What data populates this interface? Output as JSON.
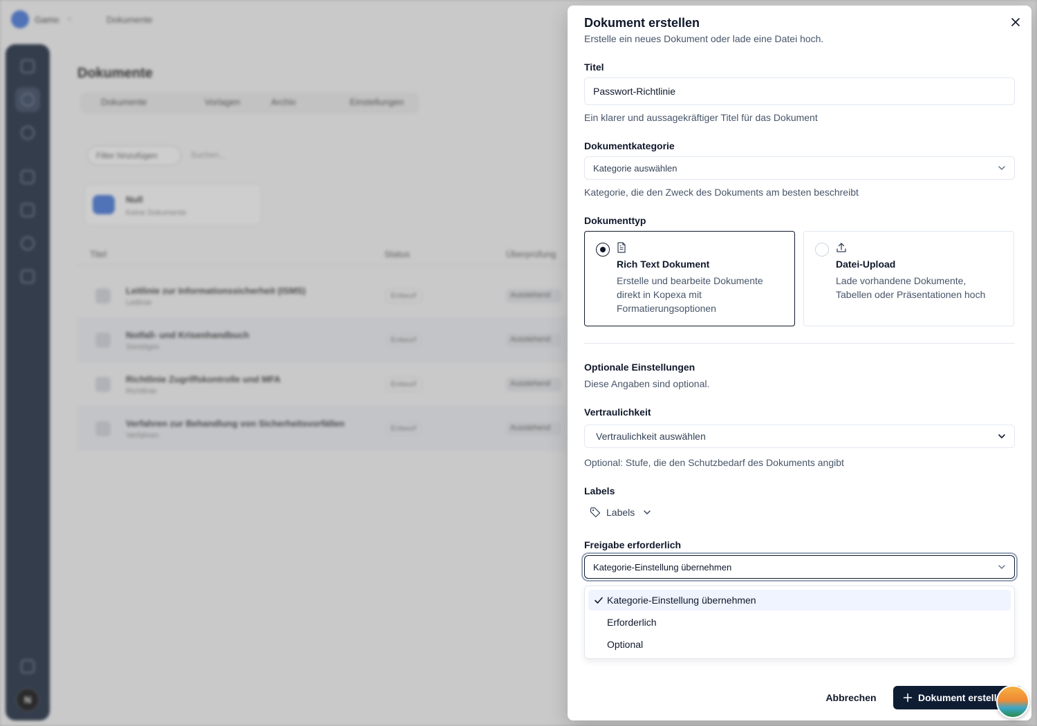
{
  "background_app": {
    "workspace_name": "Gamo",
    "top_breadcrumb": "Dokumente",
    "page_title": "Dokumente",
    "nav_tabs": [
      "Dokumente",
      "Vorlagen",
      "Archiv",
      "Einstellungen"
    ],
    "filter_label": "Filter hinzufügen",
    "search_placeholder": "Suchen...",
    "folder": {
      "name": "Null",
      "subtitle": "Keine Dokumente"
    },
    "table_headers": [
      "Titel",
      "Status",
      "Überprüfung"
    ],
    "rows": [
      {
        "title": "Leitlinie zur Informationssicherheit (ISMS)",
        "sub": "Leitlinie",
        "status": "Entwurf",
        "review": "Ausstehend"
      },
      {
        "title": "Notfall- und Krisenhandbuch",
        "sub": "Sonstiges",
        "status": "Entwurf",
        "review": "Ausstehend"
      },
      {
        "title": "Richtlinie Zugriffskontrolle und MFA",
        "sub": "Richtlinie",
        "status": "Entwurf",
        "review": "Ausstehend"
      },
      {
        "title": "Verfahren zur Behandlung von Sicherheitsvorfällen",
        "sub": "Verfahren",
        "status": "Entwurf",
        "review": "Ausstehend"
      }
    ],
    "sidebar_avatar_letter": "N"
  },
  "dialog": {
    "title": "Dokument erstellen",
    "subtitle": "Erstelle ein neues Dokument oder lade eine Datei hoch.",
    "title_field": {
      "label": "Titel",
      "value": "Passwort-Richtlinie",
      "help": "Ein klarer und aussagekräftiger Titel für das Dokument"
    },
    "category_field": {
      "label": "Dokumentkategorie",
      "placeholder": "Kategorie auswählen",
      "help": "Kategorie, die den Zweck des Dokuments am besten beschreibt"
    },
    "doctype": {
      "label": "Dokumenttyp",
      "options": [
        {
          "title": "Rich Text Dokument",
          "desc": "Erstelle und bearbeite Dokumente direkt in Kopexa mit Formatierungsoptionen",
          "selected": true
        },
        {
          "title": "Datei-Upload",
          "desc": "Lade vorhandene Dokumente, Tabellen oder Präsentationen hoch",
          "selected": false
        }
      ]
    },
    "optional": {
      "heading": "Optionale Einstellungen",
      "subheading": "Diese Angaben sind optional."
    },
    "confidentiality_field": {
      "label": "Vertraulichkeit",
      "placeholder": "Vertraulichkeit auswählen",
      "help": "Optional: Stufe, die den Schutzbedarf des Dokuments angibt"
    },
    "labels_field": {
      "label": "Labels",
      "button": "Labels"
    },
    "approval_field": {
      "label": "Freigabe erforderlich",
      "value": "Kategorie-Einstellung übernehmen",
      "options": [
        "Kategorie-Einstellung übernehmen",
        "Erforderlich",
        "Optional"
      ],
      "selected_index": 0
    },
    "buttons": {
      "cancel": "Abbrechen",
      "submit": "Dokument erstellen"
    }
  },
  "colors": {
    "primary": "#0f1d33",
    "option_highlight": "#eff4fe",
    "sidebar": "#0f1d33"
  }
}
